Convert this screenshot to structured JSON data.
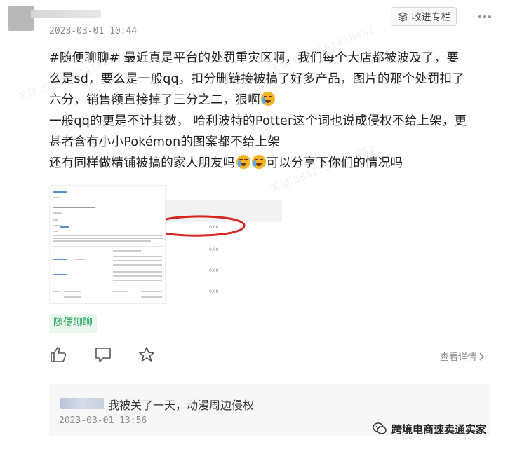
{
  "header": {
    "timestamp": "2023-03-01 10:44",
    "fav_label": "收进专栏"
  },
  "post": {
    "line1_prefix": "#随便聊聊# 最近真是平台的处罚重灾区啊，我们每个大店都被波及了，要",
    "line2": "么是sd，要么是一般qq，扣分删链接被搞了好多产品，图片的那个处罚扣了",
    "line3_text": "六分，销售额直接掉了三分之二，狠啊",
    "line4": "一般qq的更是不计其数， 哈利波特的Potter这个词也说成侵权不给上架，更",
    "line5": "甚者含有小小Pokémon的图案都不给上架",
    "line6_prefix": "还有同样做精铺被搞的家人朋友吗",
    "line6_suffix": "可以分享下你们的情况吗"
  },
  "tag_label": "随便聊聊",
  "actions": {
    "like_icon": "thumbs-up-icon",
    "comment_icon": "comment-icon",
    "star_icon": "star-icon",
    "detail_label": "查看详情"
  },
  "comment": {
    "text": "我被关了一天，动漫周边侵权",
    "timestamp": "2023-03-01 13:56"
  },
  "watermark": {
    "label": "跨境电商速卖通实家"
  },
  "screenshot": {
    "values": [
      "0.00",
      "0.00",
      "0.00",
      "0.00"
    ]
  }
}
